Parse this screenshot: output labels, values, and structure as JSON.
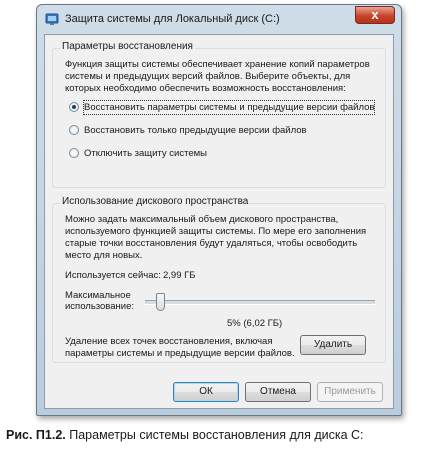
{
  "window": {
    "title": "Защита системы для Локальный диск (C:)",
    "close_label": "x"
  },
  "restore": {
    "group_label": "Параметры восстановления",
    "description": [
      "Функция защиты системы обеспечивает хранение копий параметров",
      "системы и предыдущих версий файлов. Выберите объекты, для",
      "которых необходимо обеспечить возможность восстановления:"
    ],
    "options": [
      {
        "label": "Восстановить параметры системы и предыдущие версии файлов",
        "checked": true
      },
      {
        "label": "Восстановить только предыдущие версии файлов",
        "checked": false
      },
      {
        "label": "Отключить защиту системы",
        "checked": false
      }
    ]
  },
  "disk": {
    "group_label": "Использование дискового пространства",
    "description": [
      "Можно задать максимальный объем дискового пространства,",
      "используемого функцией защиты системы. По мере его заполнения",
      "старые точки восстановления будут удаляться, чтобы освободить",
      "место для новых."
    ],
    "current_usage_label": "Используется сейчас:",
    "current_usage_value": "2,99 ГБ",
    "max_usage_label_line1": "Максимальное",
    "max_usage_label_line2": "использование:",
    "max_usage_percent": 5,
    "max_usage_value": "5% (6,02 ГБ)",
    "delete_text_line1": "Удаление всех точек восстановления, включая",
    "delete_text_line2": "параметры системы и предыдущие версии файлов.",
    "delete_button": "Удалить"
  },
  "buttons": {
    "ok": "ОК",
    "cancel": "Отмена",
    "apply": "Применить"
  },
  "caption": {
    "prefix": "Рис. П1.2.",
    "text": " Параметры системы восстановления для диска С:"
  }
}
